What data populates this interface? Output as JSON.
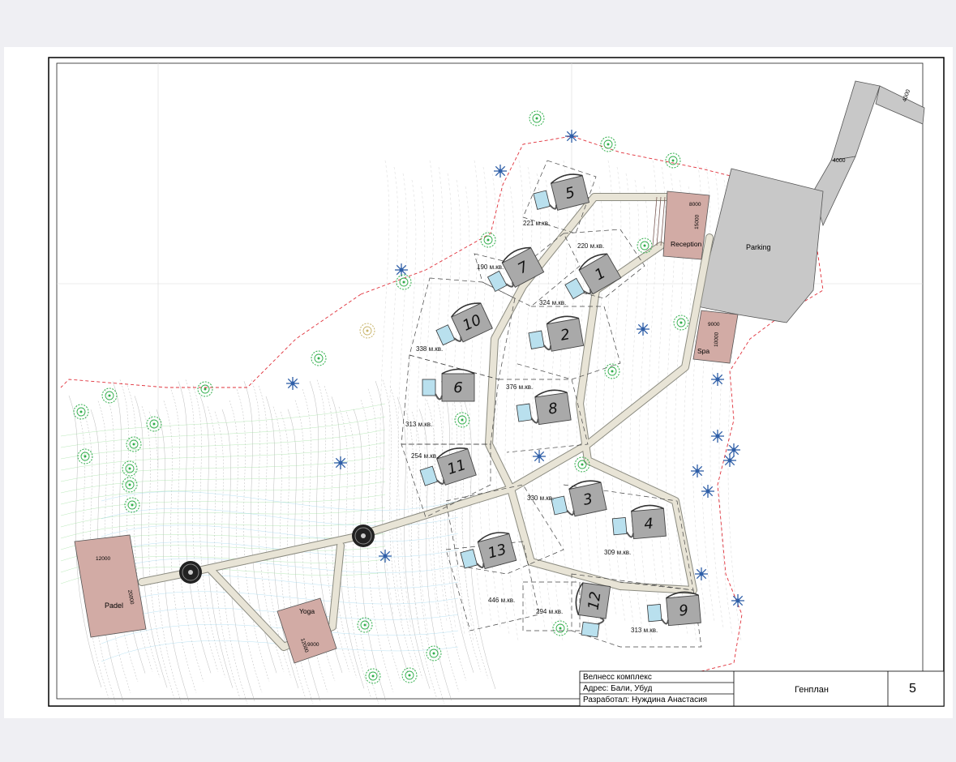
{
  "plan": {
    "houses": [
      {
        "number": "1"
      },
      {
        "number": "2"
      },
      {
        "number": "3"
      },
      {
        "number": "4"
      },
      {
        "number": "5"
      },
      {
        "number": "6"
      },
      {
        "number": "7"
      },
      {
        "number": "8"
      },
      {
        "number": "9"
      },
      {
        "number": "10"
      },
      {
        "number": "11"
      },
      {
        "number": "12"
      },
      {
        "number": "13"
      }
    ],
    "areas": [
      "221 м.кв.",
      "220 м.кв.",
      "190 м.кв.",
      "324 м.кв.",
      "338 м.кв.",
      "376 м.кв.",
      "313 м.кв.",
      "254 м.кв.",
      "330 м.кв.",
      "309 м.кв.",
      "446 м.кв.",
      "294 м.кв.",
      "313 м.кв."
    ],
    "facilities": {
      "reception": "Reception",
      "parking": "Parking",
      "spa": "Spa",
      "padel": "Padel",
      "yoga": "Yoga"
    },
    "dimensions": {
      "road_top": "4000",
      "road_mid": "4000",
      "reception_w": "8000",
      "reception_h": "15000",
      "spa_w": "9000",
      "spa_h": "10000",
      "padel_w": "12000",
      "padel_h": "20000",
      "yoga_w": "9000",
      "yoga_h": "12000"
    },
    "colors": {
      "building": "#a9a9a9",
      "facility": "#d2aba5",
      "parking": "#c8c8c8",
      "path": "#e8e4d6",
      "pool": "#b9e0ee",
      "boundary": "#e0303a"
    }
  },
  "title_block": {
    "project": "Велнесс комплекс",
    "address": "Адрес: Бали, Убуд",
    "author": "Разработал: Нуждина Анастасия",
    "sheet_name": "Генплан",
    "sheet_number": "5"
  }
}
